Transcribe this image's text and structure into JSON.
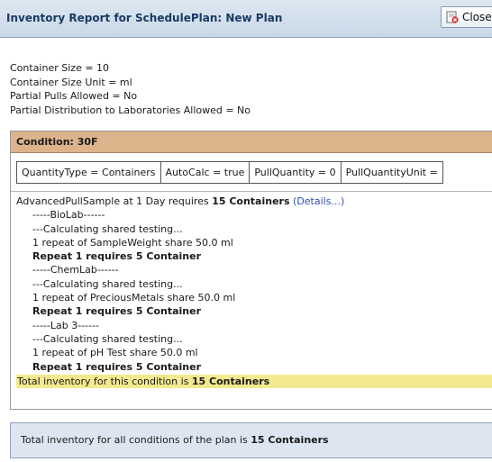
{
  "window": {
    "title": "Inventory Report for SchedulePlan: New Plan",
    "close_label": "Close"
  },
  "properties": [
    "Container Size = 10",
    "Container Size Unit = ml",
    "Partial Pulls Allowed = No",
    "Partial Distribution to Laboratories Allowed = No"
  ],
  "condition": {
    "header": "Condition: 30F",
    "settings": [
      "QuantityType = Containers",
      "AutoCalc = true",
      "PullQuantity = 0",
      "PullQuantityUnit ="
    ],
    "pull_text": "AdvancedPullSample at 1 Day requires ",
    "pull_count": "15 Containers",
    "details_label": "(Details...)",
    "labs": [
      {
        "name": "-----BioLab------",
        "calc": "---Calculating shared testing...",
        "repeat": "1 repeat of SampleWeight share 50.0 ml",
        "requires": "Repeat 1 requires 5 Container"
      },
      {
        "name": "-----ChemLab------",
        "calc": "---Calculating shared testing...",
        "repeat": "1 repeat of PreciousMetals share 50.0 ml",
        "requires": "Repeat 1 requires 5 Container"
      },
      {
        "name": "-----Lab 3------",
        "calc": "---Calculating shared testing...",
        "repeat": "1 repeat of pH Test share 50.0 ml",
        "requires": "Repeat 1 requires 5 Container"
      }
    ],
    "total_text": "Total inventory for this condition is ",
    "total_count": "15 Containers"
  },
  "grand_total": {
    "text": "Total inventory for all conditions of the plan is ",
    "count": "15 Containers"
  },
  "icons": {
    "close": "close-icon"
  }
}
